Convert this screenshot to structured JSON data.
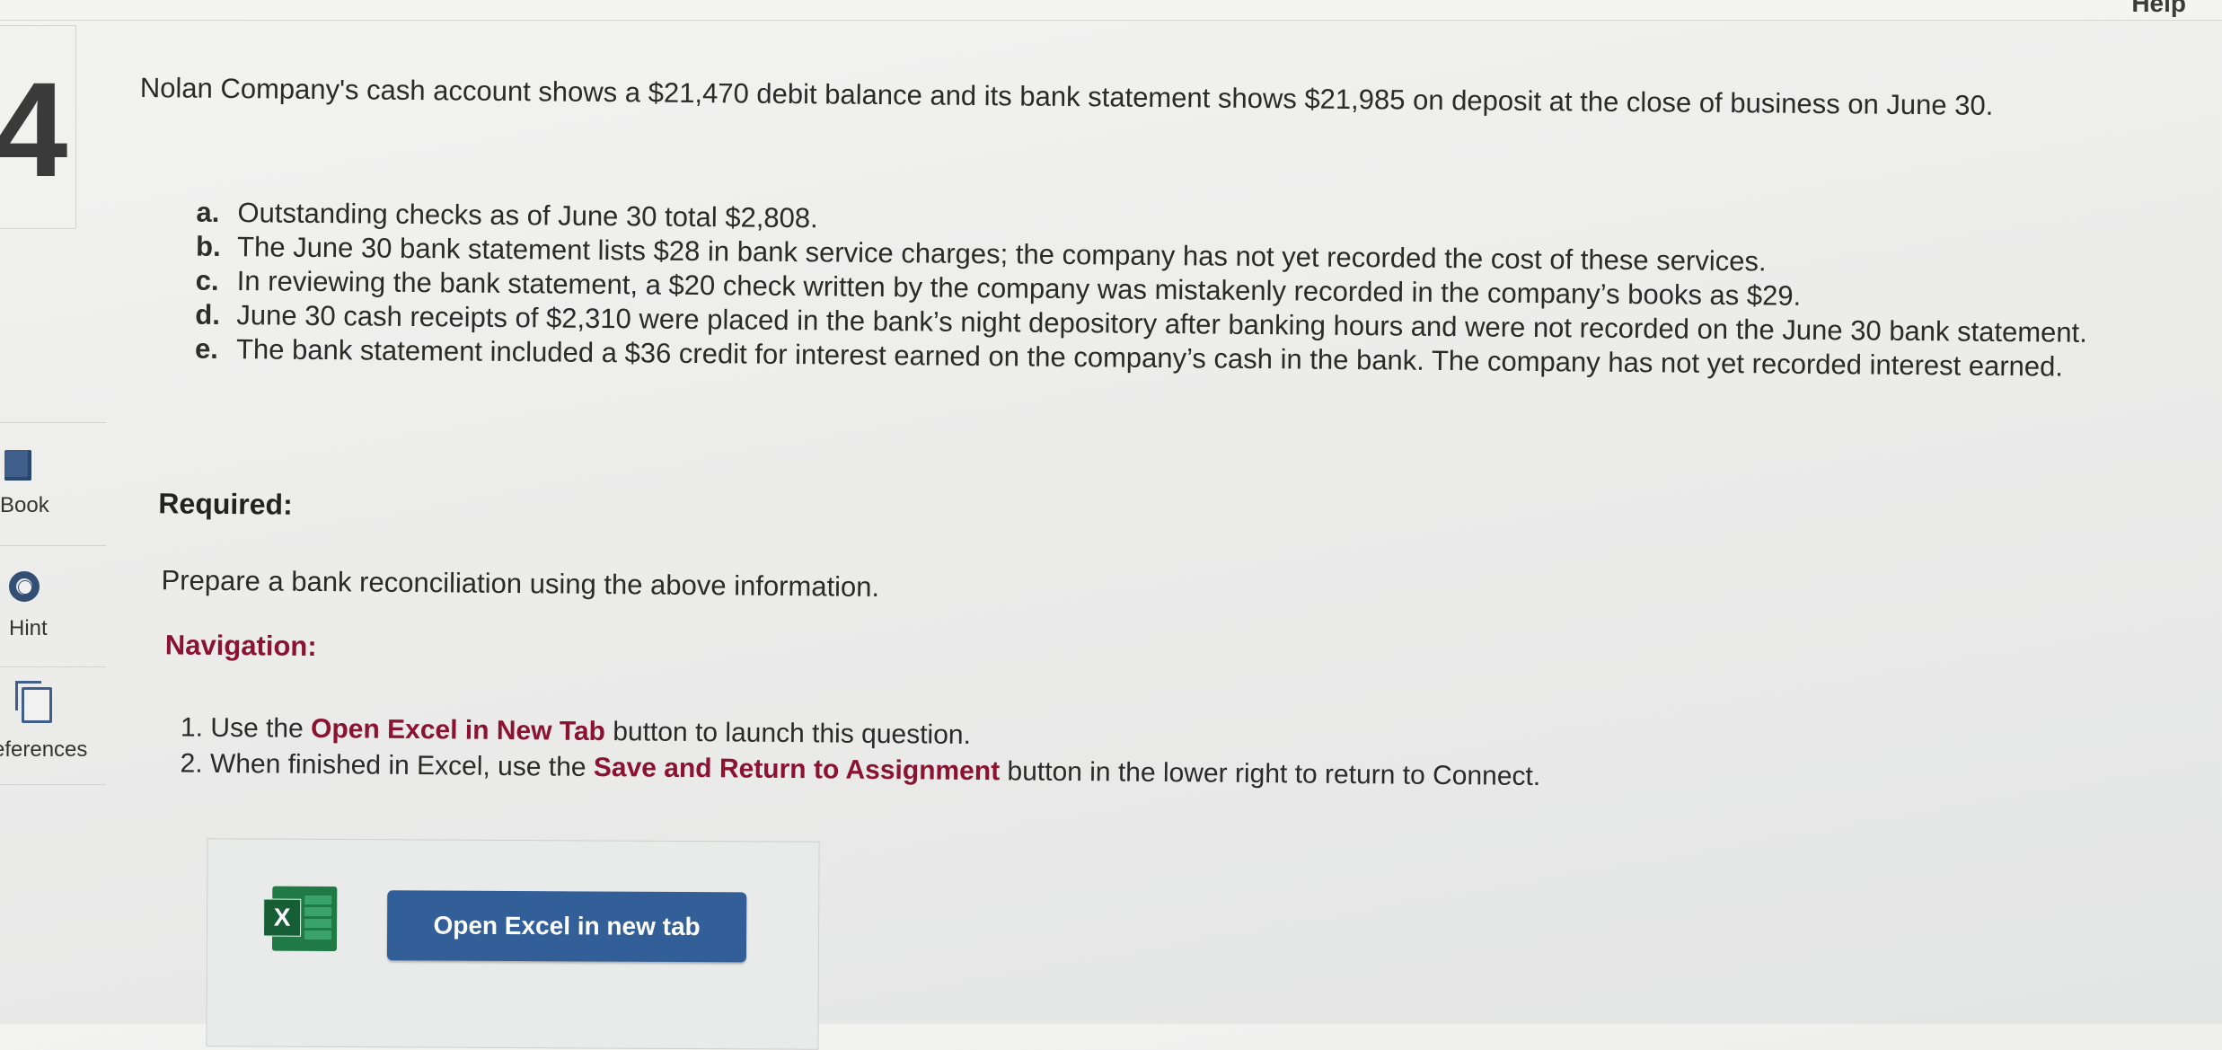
{
  "header": {
    "help_label": "Help"
  },
  "sidebar": {
    "question_number": "4",
    "tools": [
      {
        "label": "Book",
        "icon": "book-icon"
      },
      {
        "label": "Hint",
        "icon": "lifebuoy-icon"
      },
      {
        "label": "eferences",
        "icon": "references-icon"
      }
    ]
  },
  "question": {
    "intro": "Nolan Company's cash account shows a $21,470 debit balance and its bank statement shows $21,985 on deposit at the close of business on June 30.",
    "items": [
      {
        "letter": "a.",
        "text": "Outstanding checks as of June 30 total $2,808."
      },
      {
        "letter": "b.",
        "text": "The June 30 bank statement lists $28 in bank service charges; the company has not yet recorded the cost of these services."
      },
      {
        "letter": "c.",
        "text": "In reviewing the bank statement, a $20 check written by the company was mistakenly recorded in the company’s books as $29."
      },
      {
        "letter": "d.",
        "text": "June 30 cash receipts of $2,310 were placed in the bank’s night depository after banking hours and were not recorded on the June 30 bank statement."
      },
      {
        "letter": "e.",
        "text": "The bank statement included a $36 credit for interest earned on the company’s cash in the bank. The company has not yet recorded interest earned."
      }
    ],
    "required_label": "Required:",
    "task": "Prepare a bank reconciliation using the above information.",
    "navigation_label": "Navigation:",
    "steps": [
      {
        "num": "1.",
        "pre": "Use the ",
        "bold": "Open Excel in New Tab",
        "post": " button to launch this question."
      },
      {
        "num": "2.",
        "pre": "When finished in Excel, use the ",
        "bold": "Save and Return to Assignment",
        "post": " button in the lower right to return to Connect."
      }
    ]
  },
  "excel_panel": {
    "icon_letter": "X",
    "button_label": "Open Excel in new tab"
  },
  "colors": {
    "navigation": "#8b1230",
    "button": "#335f99",
    "excel": "#1f7a46"
  }
}
